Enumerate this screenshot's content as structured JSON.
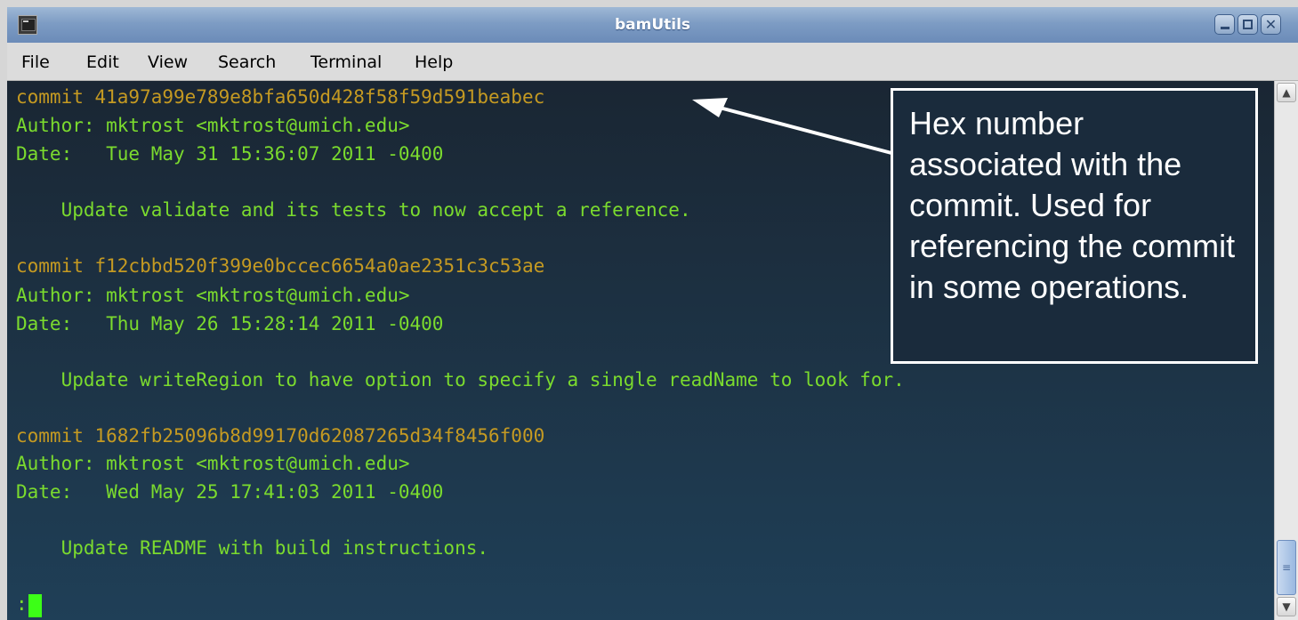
{
  "window": {
    "title": "bamUtils",
    "app_icon": "terminal-icon",
    "buttons": {
      "minimize": "minimize-icon",
      "maximize": "maximize-icon",
      "close": "close-icon",
      "close_glyph": "✕"
    }
  },
  "menubar": {
    "items": [
      "File",
      "Edit",
      "View",
      "Search",
      "Terminal",
      "Help"
    ]
  },
  "terminal": {
    "lines": [
      "commit 41a97a99e789e8bfa650d428f58f59d591beabec",
      "Author: mktrost <mktrost@umich.edu>",
      "Date:   Tue May 31 15:36:07 2011 -0400",
      "    Update validate and its tests to now accept a reference.",
      "commit f12cbbd520f399e0bccec6654a0ae2351c3c53ae",
      "Author: mktrost <mktrost@umich.edu>",
      "Date:   Thu May 26 15:28:14 2011 -0400",
      "    Update writeRegion to have option to specify a single readName to look for.",
      "commit 1682fb25096b8d99170d62087265d34f8456f000",
      "Author: mktrost <mktrost@umich.edu>",
      "Date:   Wed May 25 17:41:03 2011 -0400",
      "    Update README with build instructions."
    ],
    "prompt": ":",
    "colors": {
      "commit": "#c59a22",
      "text": "#7bdb2e",
      "cursor": "#3cff17",
      "background": "#1d3447"
    }
  },
  "scrollbar": {
    "up_arrow": "▲",
    "down_arrow": "▼",
    "grip": "≡"
  },
  "callout": {
    "text": "Hex number associated with the commit.  Used for referencing the commit in some operations."
  }
}
